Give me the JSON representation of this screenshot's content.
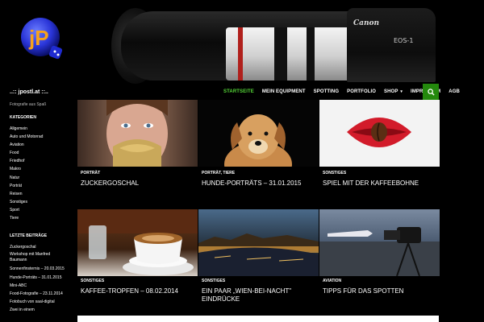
{
  "header": {
    "camera_brand": "Canon",
    "camera_model": "EOS-1",
    "logo_text": "jP"
  },
  "site": {
    "title": "..:: jpostl.at ::..",
    "description": "Fotografie aus Spaß"
  },
  "nav": {
    "items": [
      {
        "label": "STARTSEITE",
        "active": true
      },
      {
        "label": "MEIN EQUIPMENT"
      },
      {
        "label": "SPOTTING"
      },
      {
        "label": "PORTFOLIO"
      },
      {
        "label": "SHOP",
        "dropdown": true
      },
      {
        "label": "IMPRESSUM"
      },
      {
        "label": "AGB"
      }
    ],
    "dropdown_caret": "▾",
    "accent": "#55d737",
    "search_bg": "#24890d"
  },
  "sidebar": {
    "categories_title": "KATEGORIEN",
    "categories": [
      "Allgemein",
      "Auto und Motorrad",
      "Aviation",
      "Food",
      "Friedhof",
      "Makro",
      "Natur",
      "Porträt",
      "Reisen",
      "Sonstiges",
      "Sport",
      "Tiere"
    ],
    "recent_title": "LETZTE BEITRÄGE",
    "recent": [
      "Zuckergoschal",
      "Workshop mit Manfred Baumann",
      "Sonnenfinsternis – 20.03.2015",
      "Hunde-Porträts – 31.01.2015",
      "Mini-ABC",
      "Food-Fotografie – 23.11.2014",
      "Fotobuch von saal-digital",
      "Zwei in einem"
    ]
  },
  "posts": [
    {
      "category": "PORTRÄT",
      "title": "ZUCKERGOSCHAL",
      "image": "woman-glitter-lips"
    },
    {
      "category": "PORTRÄT, TIERE",
      "title": "HUNDE-PORTRÄTS – 31.01.2015",
      "image": "dog-portrait"
    },
    {
      "category": "SONSTIGES",
      "title": "SPIEL MIT DER KAFFEEBOHNE",
      "image": "red-lips-coffee-bean"
    },
    {
      "category": "SONSTIGES",
      "title": "KAFFEE-TROPFEN – 08.02.2014",
      "image": "coffee-cup"
    },
    {
      "category": "SONSTIGES",
      "title": "EIN PAAR „WIEN-BEI-NACHT\" EINDRÜCKE",
      "image": "vienna-night"
    },
    {
      "category": "AVIATION",
      "title": "TIPPS FÜR DAS SPOTTEN",
      "image": "airport-camera"
    }
  ]
}
